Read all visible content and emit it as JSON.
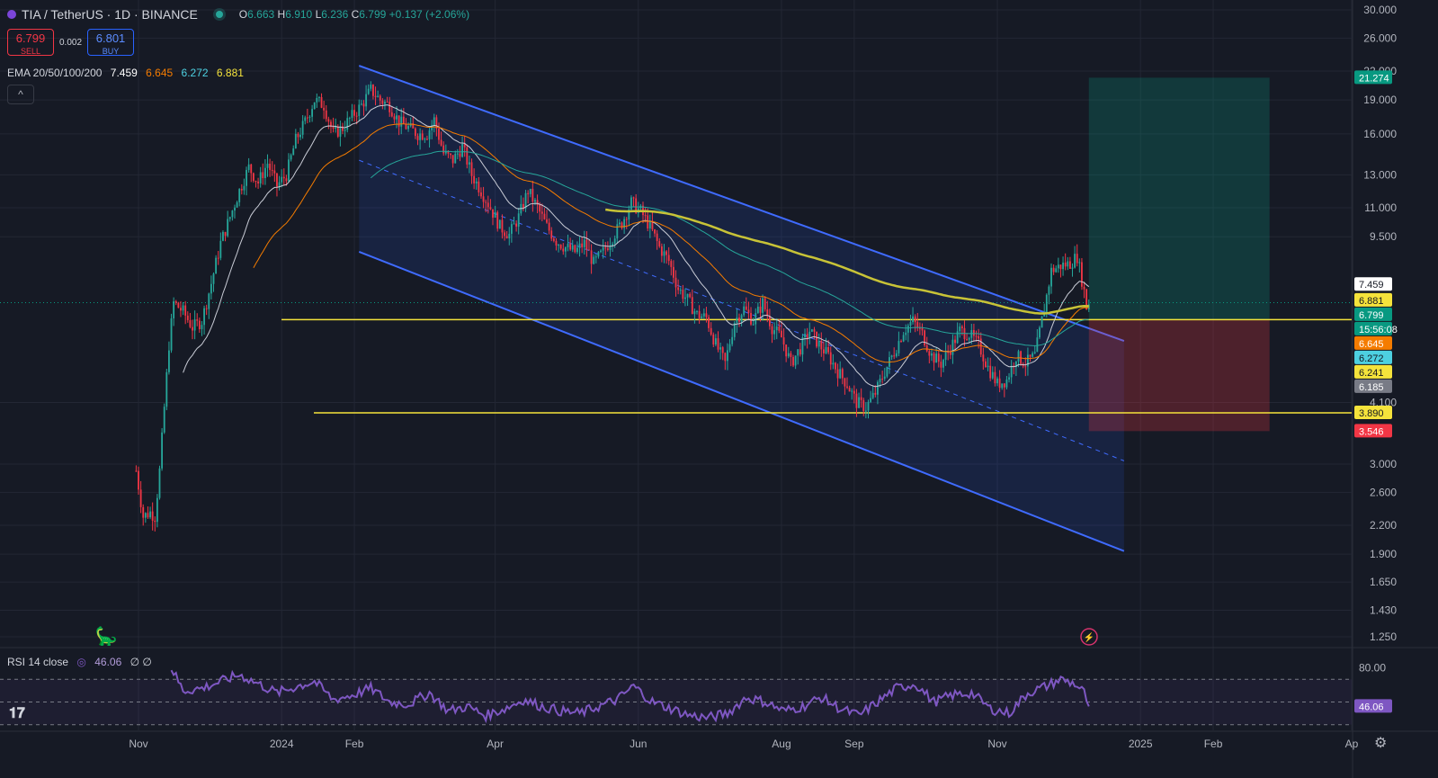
{
  "header": {
    "symbol": "TIA / TetherUS · 1D · BINANCE",
    "o_label": "O",
    "o_value": "6.663",
    "h_label": "H",
    "h_value": "6.910",
    "l_label": "L",
    "l_value": "6.236",
    "c_label": "C",
    "c_value": "6.799",
    "change": "+0.137 (+2.06%)"
  },
  "trade": {
    "sell_price": "6.799",
    "sell_label": "SELL",
    "spread": "0.002",
    "buy_price": "6.801",
    "buy_label": "BUY"
  },
  "ema": {
    "label": "EMA 20/50/100/200",
    "v20": "7.459",
    "v50": "6.645",
    "v100": "6.272",
    "v200": "6.881"
  },
  "collapse_icon": "chevron-up-icon",
  "rsi": {
    "label": "RSI 14 close",
    "value": "46.06",
    "extra": "∅ ∅"
  },
  "colors": {
    "background": "#161a25",
    "up": "#26a69a",
    "down": "#f23645",
    "ema20": "#c9ccd6",
    "ema50": "#f57c00",
    "ema100": "#26a69a",
    "ema200": "#c8c337",
    "channel": "#2962ff",
    "support": "#f5e33b",
    "rsi": "#7e57c2"
  },
  "chart_data": {
    "type": "candlestick",
    "symbol": "TIA / TetherUS",
    "timeframe": "1D",
    "exchange": "BINANCE",
    "y_scale": "log",
    "ylim": [
      1.15,
      32.0
    ],
    "y_ticks": [
      "30.000",
      "26.000",
      "22.000",
      "19.000",
      "16.000",
      "13.000",
      "11.000",
      "9.500",
      "4.100",
      "3.000",
      "2.600",
      "2.200",
      "1.900",
      "1.650",
      "1.430",
      "1.250"
    ],
    "x_ticks": [
      {
        "label": "Nov",
        "date": "2023-11-01"
      },
      {
        "label": "2024",
        "date": "2024-01-01"
      },
      {
        "label": "Feb",
        "date": "2024-02-01"
      },
      {
        "label": "Apr",
        "date": "2024-04-01"
      },
      {
        "label": "Jun",
        "date": "2024-06-01"
      },
      {
        "label": "Aug",
        "date": "2024-08-01"
      },
      {
        "label": "Sep",
        "date": "2024-09-01"
      },
      {
        "label": "Nov",
        "date": "2024-11-01"
      },
      {
        "label": "2025",
        "date": "2025-01-01"
      },
      {
        "label": "Feb",
        "date": "2025-02-01"
      },
      {
        "label": "Ap",
        "date": "2025-04-01"
      }
    ],
    "price_path": [
      [
        "2023-10-31",
        2.9
      ],
      [
        "2023-11-03",
        2.3
      ],
      [
        "2023-11-06",
        2.35
      ],
      [
        "2023-11-08",
        2.3
      ],
      [
        "2023-11-10",
        2.9
      ],
      [
        "2023-11-12",
        4.0
      ],
      [
        "2023-11-14",
        5.5
      ],
      [
        "2023-11-16",
        6.8
      ],
      [
        "2023-11-20",
        6.5
      ],
      [
        "2023-11-24",
        6.0
      ],
      [
        "2023-11-28",
        6.2
      ],
      [
        "2023-12-02",
        7.5
      ],
      [
        "2023-12-06",
        9.2
      ],
      [
        "2023-12-10",
        10.5
      ],
      [
        "2023-12-14",
        12.0
      ],
      [
        "2023-12-18",
        13.5
      ],
      [
        "2023-12-22",
        12.5
      ],
      [
        "2023-12-26",
        13.8
      ],
      [
        "2023-12-30",
        12.3
      ],
      [
        "2024-01-03",
        13.0
      ],
      [
        "2024-01-07",
        15.5
      ],
      [
        "2024-01-11",
        17.0
      ],
      [
        "2024-01-15",
        19.0
      ],
      [
        "2024-01-19",
        18.5
      ],
      [
        "2024-01-23",
        16.0
      ],
      [
        "2024-01-27",
        16.5
      ],
      [
        "2024-01-31",
        17.5
      ],
      [
        "2024-02-04",
        18.5
      ],
      [
        "2024-02-08",
        20.0
      ],
      [
        "2024-02-12",
        19.0
      ],
      [
        "2024-02-16",
        18.5
      ],
      [
        "2024-02-20",
        17.0
      ],
      [
        "2024-02-24",
        16.5
      ],
      [
        "2024-02-28",
        16.0
      ],
      [
        "2024-03-03",
        16.0
      ],
      [
        "2024-03-06",
        17.2
      ],
      [
        "2024-03-10",
        14.5
      ],
      [
        "2024-03-14",
        14.0
      ],
      [
        "2024-03-18",
        15.0
      ],
      [
        "2024-03-22",
        13.0
      ],
      [
        "2024-03-26",
        12.0
      ],
      [
        "2024-03-30",
        11.0
      ],
      [
        "2024-04-03",
        10.0
      ],
      [
        "2024-04-07",
        9.6
      ],
      [
        "2024-04-11",
        10.5
      ],
      [
        "2024-04-15",
        12.0
      ],
      [
        "2024-04-19",
        11.0
      ],
      [
        "2024-04-23",
        10.0
      ],
      [
        "2024-04-27",
        9.3
      ],
      [
        "2024-05-01",
        9.0
      ],
      [
        "2024-05-05",
        8.8
      ],
      [
        "2024-05-09",
        9.2
      ],
      [
        "2024-05-13",
        8.3
      ],
      [
        "2024-05-17",
        8.8
      ],
      [
        "2024-05-21",
        9.5
      ],
      [
        "2024-05-25",
        10.2
      ],
      [
        "2024-05-29",
        11.3
      ],
      [
        "2024-06-02",
        10.8
      ],
      [
        "2024-06-06",
        10.0
      ],
      [
        "2024-06-10",
        9.0
      ],
      [
        "2024-06-14",
        8.4
      ],
      [
        "2024-06-18",
        7.3
      ],
      [
        "2024-06-22",
        6.9
      ],
      [
        "2024-06-26",
        6.4
      ],
      [
        "2024-06-30",
        6.3
      ],
      [
        "2024-07-04",
        5.5
      ],
      [
        "2024-07-08",
        5.0
      ],
      [
        "2024-07-12",
        6.2
      ],
      [
        "2024-07-16",
        6.6
      ],
      [
        "2024-07-20",
        6.2
      ],
      [
        "2024-07-24",
        6.8
      ],
      [
        "2024-07-28",
        6.0
      ],
      [
        "2024-08-01",
        5.7
      ],
      [
        "2024-08-05",
        5.0
      ],
      [
        "2024-08-09",
        5.4
      ],
      [
        "2024-08-13",
        5.9
      ],
      [
        "2024-08-17",
        5.5
      ],
      [
        "2024-08-21",
        5.2
      ],
      [
        "2024-08-25",
        4.8
      ],
      [
        "2024-08-29",
        4.5
      ],
      [
        "2024-09-02",
        4.1
      ],
      [
        "2024-09-06",
        4.0
      ],
      [
        "2024-09-10",
        4.3
      ],
      [
        "2024-09-14",
        4.8
      ],
      [
        "2024-09-18",
        5.3
      ],
      [
        "2024-09-22",
        5.9
      ],
      [
        "2024-09-26",
        6.2
      ],
      [
        "2024-09-30",
        5.8
      ],
      [
        "2024-10-04",
        5.2
      ],
      [
        "2024-10-08",
        5.0
      ],
      [
        "2024-10-12",
        5.4
      ],
      [
        "2024-10-16",
        5.9
      ],
      [
        "2024-10-20",
        5.8
      ],
      [
        "2024-10-24",
        5.5
      ],
      [
        "2024-10-28",
        4.9
      ],
      [
        "2024-11-01",
        4.5
      ],
      [
        "2024-11-05",
        4.6
      ],
      [
        "2024-11-09",
        5.2
      ],
      [
        "2024-11-13",
        5.0
      ],
      [
        "2024-11-17",
        5.2
      ],
      [
        "2024-11-21",
        6.6
      ],
      [
        "2024-11-24",
        8.0
      ],
      [
        "2024-11-28",
        8.2
      ],
      [
        "2024-12-02",
        8.3
      ],
      [
        "2024-12-05",
        8.6
      ],
      [
        "2024-12-08",
        7.2
      ],
      [
        "2024-12-09",
        6.66
      ],
      [
        "2024-12-10",
        6.799
      ]
    ],
    "ema_values": {
      "ema20": 7.459,
      "ema50": 6.645,
      "ema100": 6.272,
      "ema200": 6.881
    },
    "channel": {
      "upper_start": [
        "2024-02-03",
        22.6
      ],
      "upper_end": [
        "2024-12-25",
        5.6
      ],
      "lower_start": [
        "2024-02-03",
        8.8
      ],
      "lower_end": [
        "2024-12-25",
        1.93
      ],
      "mid_start": [
        "2024-02-03",
        14.0
      ],
      "mid_end": [
        "2024-12-25",
        3.05
      ]
    },
    "horizontal_lines": [
      6.241,
      3.89
    ],
    "long_position": {
      "start": "2024-12-10",
      "end": "2025-02-25",
      "entry": 6.241,
      "target": 21.274,
      "stop": 3.546
    },
    "price_labels": [
      {
        "text": "21.274",
        "value": 21.274,
        "color": "#089981"
      },
      {
        "text": "7.459",
        "value": 7.459,
        "color": "#ffffff"
      },
      {
        "text": "6.881",
        "value": 6.881,
        "color": "#f5e33b"
      },
      {
        "text": "6.799",
        "value": 6.799,
        "color": "#089981"
      },
      {
        "text": "15:56:08",
        "value": 6.5,
        "color": "#089981"
      },
      {
        "text": "6.645",
        "value": 6.645,
        "color": "#f57c00"
      },
      {
        "text": "6.272",
        "value": 6.272,
        "color": "#4dd0e1"
      },
      {
        "text": "6.241",
        "value": 6.241,
        "color": "#f5e33b"
      },
      {
        "text": "6.185",
        "value": 6.185,
        "color": "#787b86"
      },
      {
        "text": "3.890",
        "value": 3.89,
        "color": "#f5e33b"
      },
      {
        "text": "3.546",
        "value": 3.546,
        "color": "#f23645"
      }
    ],
    "rsi": {
      "ylim": [
        25,
        90
      ],
      "y_ticks": [
        "80.00"
      ],
      "levels": [
        70,
        50,
        30
      ],
      "current": 46.06,
      "path": [
        [
          "2023-11-15",
          80
        ],
        [
          "2023-11-20",
          60
        ],
        [
          "2023-11-28",
          62
        ],
        [
          "2023-12-06",
          68
        ],
        [
          "2023-12-14",
          74
        ],
        [
          "2023-12-22",
          66
        ],
        [
          "2023-12-30",
          58
        ],
        [
          "2024-01-08",
          64
        ],
        [
          "2024-01-15",
          68
        ],
        [
          "2024-01-23",
          52
        ],
        [
          "2024-01-31",
          56
        ],
        [
          "2024-02-08",
          62
        ],
        [
          "2024-02-16",
          50
        ],
        [
          "2024-02-24",
          48
        ],
        [
          "2024-03-04",
          58
        ],
        [
          "2024-03-12",
          42
        ],
        [
          "2024-03-20",
          46
        ],
        [
          "2024-03-28",
          38
        ],
        [
          "2024-04-05",
          44
        ],
        [
          "2024-04-13",
          52
        ],
        [
          "2024-04-21",
          46
        ],
        [
          "2024-04-29",
          42
        ],
        [
          "2024-05-07",
          40
        ],
        [
          "2024-05-15",
          46
        ],
        [
          "2024-05-23",
          52
        ],
        [
          "2024-05-30",
          64
        ],
        [
          "2024-06-07",
          50
        ],
        [
          "2024-06-15",
          44
        ],
        [
          "2024-06-23",
          38
        ],
        [
          "2024-07-01",
          36
        ],
        [
          "2024-07-09",
          40
        ],
        [
          "2024-07-17",
          54
        ],
        [
          "2024-07-25",
          50
        ],
        [
          "2024-08-02",
          42
        ],
        [
          "2024-08-10",
          46
        ],
        [
          "2024-08-18",
          54
        ],
        [
          "2024-08-26",
          44
        ],
        [
          "2024-09-03",
          38
        ],
        [
          "2024-09-11",
          50
        ],
        [
          "2024-09-19",
          62
        ],
        [
          "2024-09-27",
          66
        ],
        [
          "2024-10-05",
          50
        ],
        [
          "2024-10-13",
          56
        ],
        [
          "2024-10-21",
          58
        ],
        [
          "2024-10-29",
          44
        ],
        [
          "2024-11-06",
          40
        ],
        [
          "2024-11-14",
          58
        ],
        [
          "2024-11-22",
          64
        ],
        [
          "2024-11-28",
          70
        ],
        [
          "2024-12-04",
          66
        ],
        [
          "2024-12-08",
          58
        ],
        [
          "2024-12-10",
          46.06
        ]
      ]
    }
  }
}
